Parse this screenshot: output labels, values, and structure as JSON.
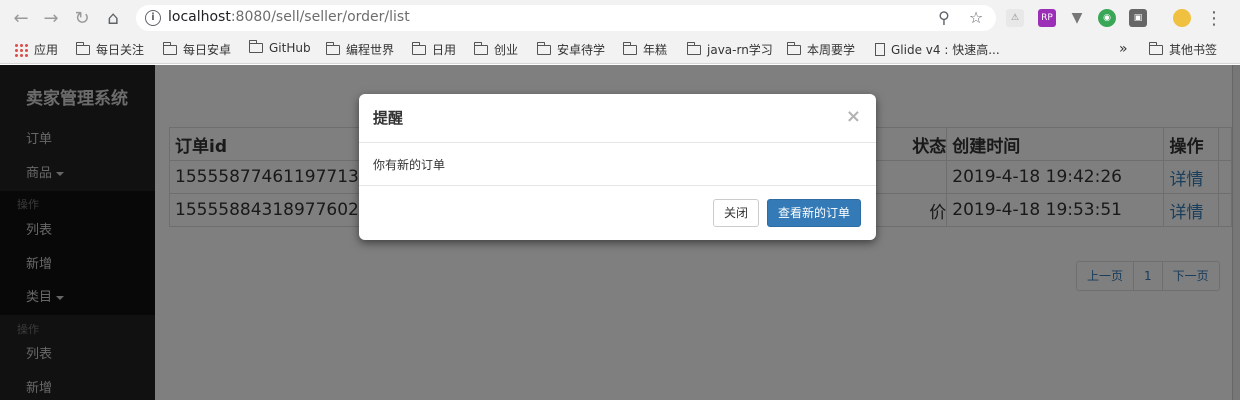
{
  "browser": {
    "url_host": "localhost",
    "url_rest": ":8080/sell/seller/order/list"
  },
  "bookmarks": {
    "items": [
      "应用",
      "每日关注",
      "每日安卓",
      "GitHub",
      "编程世界",
      "日用",
      "创业",
      "安卓待学",
      "年糕",
      "java-rn学习",
      "本周要学",
      "Glide v4 : 快速高..."
    ],
    "overflow": "»",
    "other": "其他书签"
  },
  "sidebar": {
    "brand": "卖家管理系统",
    "orders": "订单",
    "products": "商品",
    "products_header": "操作",
    "products_list": "列表",
    "products_add": "新增",
    "category": "类目",
    "category_header": "操作",
    "category_list": "列表",
    "category_add": "新增"
  },
  "table": {
    "headers": [
      "订单id",
      "状态",
      "创建时间",
      "操作"
    ],
    "rows": [
      {
        "id": "1555587746119771327",
        "status": "",
        "created": "2019-4-18 19:42:26",
        "action": "详情"
      },
      {
        "id": "1555588431897760210",
        "status": "价",
        "created": "2019-4-18 19:53:51",
        "action": "详情"
      }
    ]
  },
  "pagination": {
    "prev": "上一页",
    "page": "1",
    "next": "下一页"
  },
  "modal": {
    "title": "提醒",
    "close_symbol": "×",
    "body": "你有新的订单",
    "close_button": "关闭",
    "view_button": "查看新的订单"
  },
  "colors": {
    "primary": "#337ab7",
    "sidebar_bg": "#222222",
    "backdrop": "rgba(0,0,0,0.5)"
  }
}
